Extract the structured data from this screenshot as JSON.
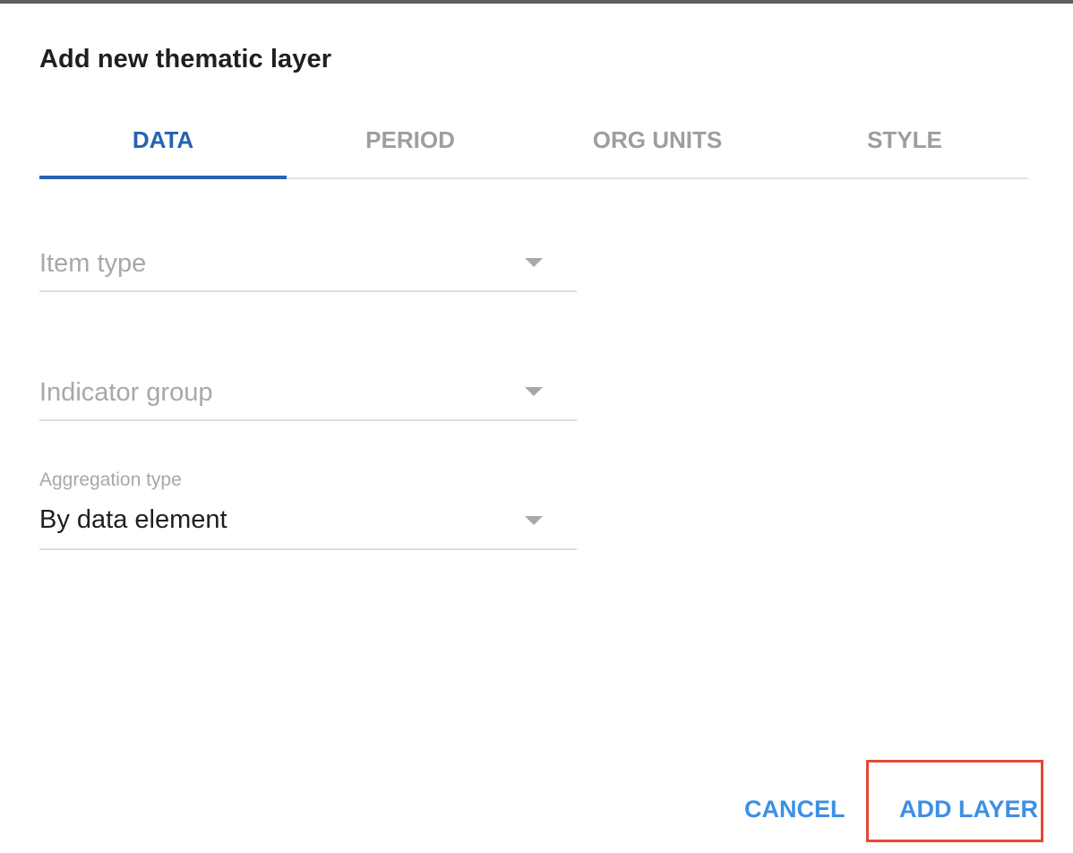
{
  "dialog": {
    "title": "Add new thematic layer",
    "tabs": [
      {
        "label": "DATA",
        "active": true
      },
      {
        "label": "PERIOD",
        "active": false
      },
      {
        "label": "ORG UNITS",
        "active": false
      },
      {
        "label": "STYLE",
        "active": false
      }
    ],
    "fields": {
      "item_type": {
        "placeholder": "Item type"
      },
      "indicator_group": {
        "placeholder": "Indicator group"
      },
      "aggregation_type": {
        "label": "Aggregation type",
        "value": "By data element"
      }
    },
    "actions": {
      "cancel_label": "CANCEL",
      "add_layer_label": "ADD LAYER"
    }
  },
  "colors": {
    "accent": "#2762b0",
    "button": "#3d8fe6",
    "highlight": "#e24a33"
  }
}
